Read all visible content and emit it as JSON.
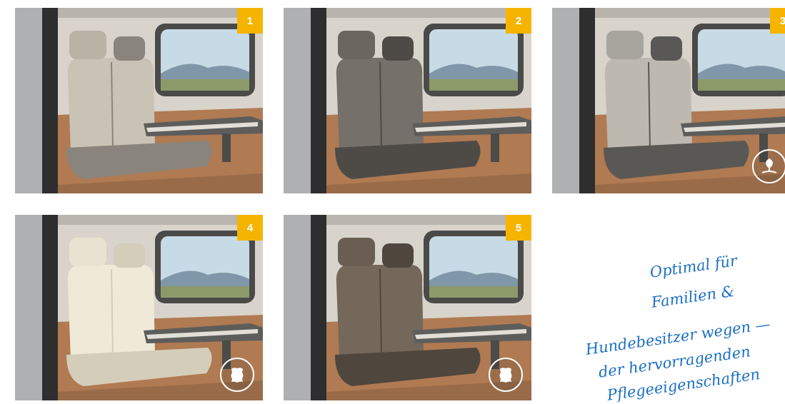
{
  "tiles": [
    {
      "number": "1",
      "seat": "#b9b3a6",
      "seat_dark": "#8a857c",
      "back": "#c9c3b5",
      "feature": null
    },
    {
      "number": "2",
      "seat": "#6b6760",
      "seat_dark": "#4e4b46",
      "back": "#75716a",
      "feature": null
    },
    {
      "number": "3",
      "seat": "#a8a59e",
      "seat_dark": "#5a5854",
      "back": "#bdb9b0",
      "feature": "eco-icon"
    },
    {
      "number": "4",
      "seat": "#e8e2d0",
      "seat_dark": "#d4cdb9",
      "back": "#efe9d8",
      "feature": "leather-icon"
    },
    {
      "number": "5",
      "seat": "#6a5e52",
      "seat_dark": "#4f463d",
      "back": "#74685b",
      "feature": "leather-icon"
    }
  ],
  "note": {
    "line1": "Optimal für",
    "line2": "Familien &",
    "line3": "Hundebesitzer wegen —",
    "line4": "der hervorragenden",
    "line5": "Pflegeeigenschaften",
    "color": "#1a6fc4"
  },
  "colors": {
    "badge": "#f5b400",
    "wood": "#b07a52",
    "wall": "#d8d4cc"
  }
}
